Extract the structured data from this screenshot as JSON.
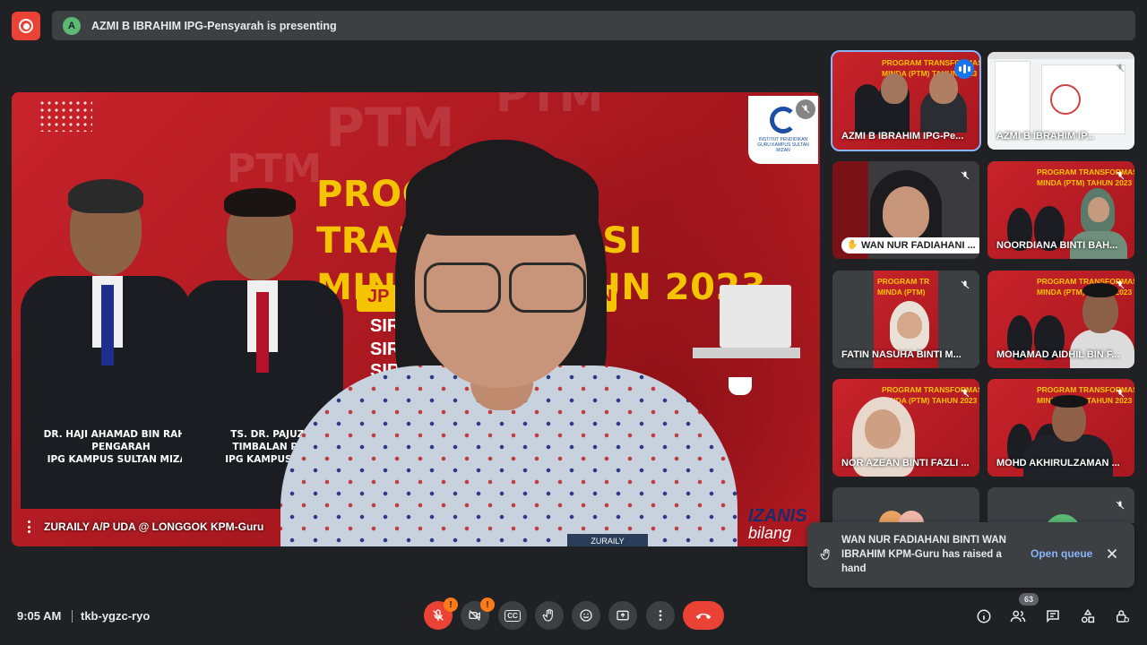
{
  "header": {
    "presenter_initial": "A",
    "presenting_text": "AZMI B IBRAHIM IPG-Pensyarah is presenting"
  },
  "main": {
    "slide": {
      "title_line1": "PROG",
      "title_line1_end": "TRANSFORMASI",
      "title_line2": "MIND",
      "title_line2_end": "HUN 2023",
      "siri": [
        "SIRI",
        "SIRI",
        "SIRI"
      ],
      "jp_text": "JP",
      "jp_text_end": "N",
      "speaker1_name": "DR. HAJI AHAMAD BIN RAHIM",
      "speaker1_role": "PENGARAH",
      "speaker1_org": "IPG KAMPUS SULTAN MIZAN",
      "speaker2_name": "TS. DR. PAJUZI BI",
      "speaker2_role": "TIMBALAN PENG",
      "speaker2_org": "IPG KAMPUS SULTA",
      "brand_word": "IZANIS",
      "brand_sub": "bilang",
      "logo_text": "INSTITUT PENDIDIKAN GURU KAMPUS SULTAN MIZAN",
      "watermark": "PTM"
    },
    "presenter_tag": "ZURAILY",
    "label": "ZURAILY A/P UDA @ LONGGOK KPM-Guru"
  },
  "tiles": [
    {
      "label": "AZMI B IBRAHIM IPG-Pe...",
      "title": "PROGRAM TRANSFORMASI",
      "title2": "MINDA (PTM) TAHUN 2023"
    },
    {
      "label": "AZMI B IBRAHIM IP..."
    },
    {
      "label": "WAN NUR FADIAHANI ..."
    },
    {
      "label": "NOORDIANA BINTI BAH...",
      "title": "PROGRAM TRANSFORMASI",
      "title2": "MINDA (PTM) TAHUN 2023"
    },
    {
      "label": "FATIN NASUHA BINTI M...",
      "title": "PROGRAM TR",
      "title2": "MINDA (PTM)"
    },
    {
      "label": "MOHAMAD AIDHIL BIN F...",
      "title": "PROGRAM TRANSFORMASI",
      "title2": "MINDA (PTM) TAHUN 2023"
    },
    {
      "label": "NOR AZEAN BINTI FAZLI ...",
      "title": "PROGRAM TRANSFORMASI",
      "title2": "MINDA (PTM) TAHUN 2023"
    },
    {
      "label": "MOHD AKHIRULZAMAN ...",
      "title": "PROGRAM TRANSFORMASI",
      "title2": "MINDA (PTM) TAHUN 2023"
    }
  ],
  "notification": {
    "message": "WAN NUR FADIAHANI BINTI WAN IBRAHIM KPM-Guru has raised a hand",
    "action": "Open queue"
  },
  "footer": {
    "time": "9:05 AM",
    "meeting_code": "tkb-ygzc-ryo",
    "participant_count": "63",
    "mic_warning": "!",
    "cam_warning": "!",
    "cc_label": "CC"
  },
  "colors": {
    "accent": "#8ab4f8",
    "danger": "#ea4335",
    "warning": "#fa7b17",
    "surface": "#3c4043",
    "background": "#202124"
  }
}
